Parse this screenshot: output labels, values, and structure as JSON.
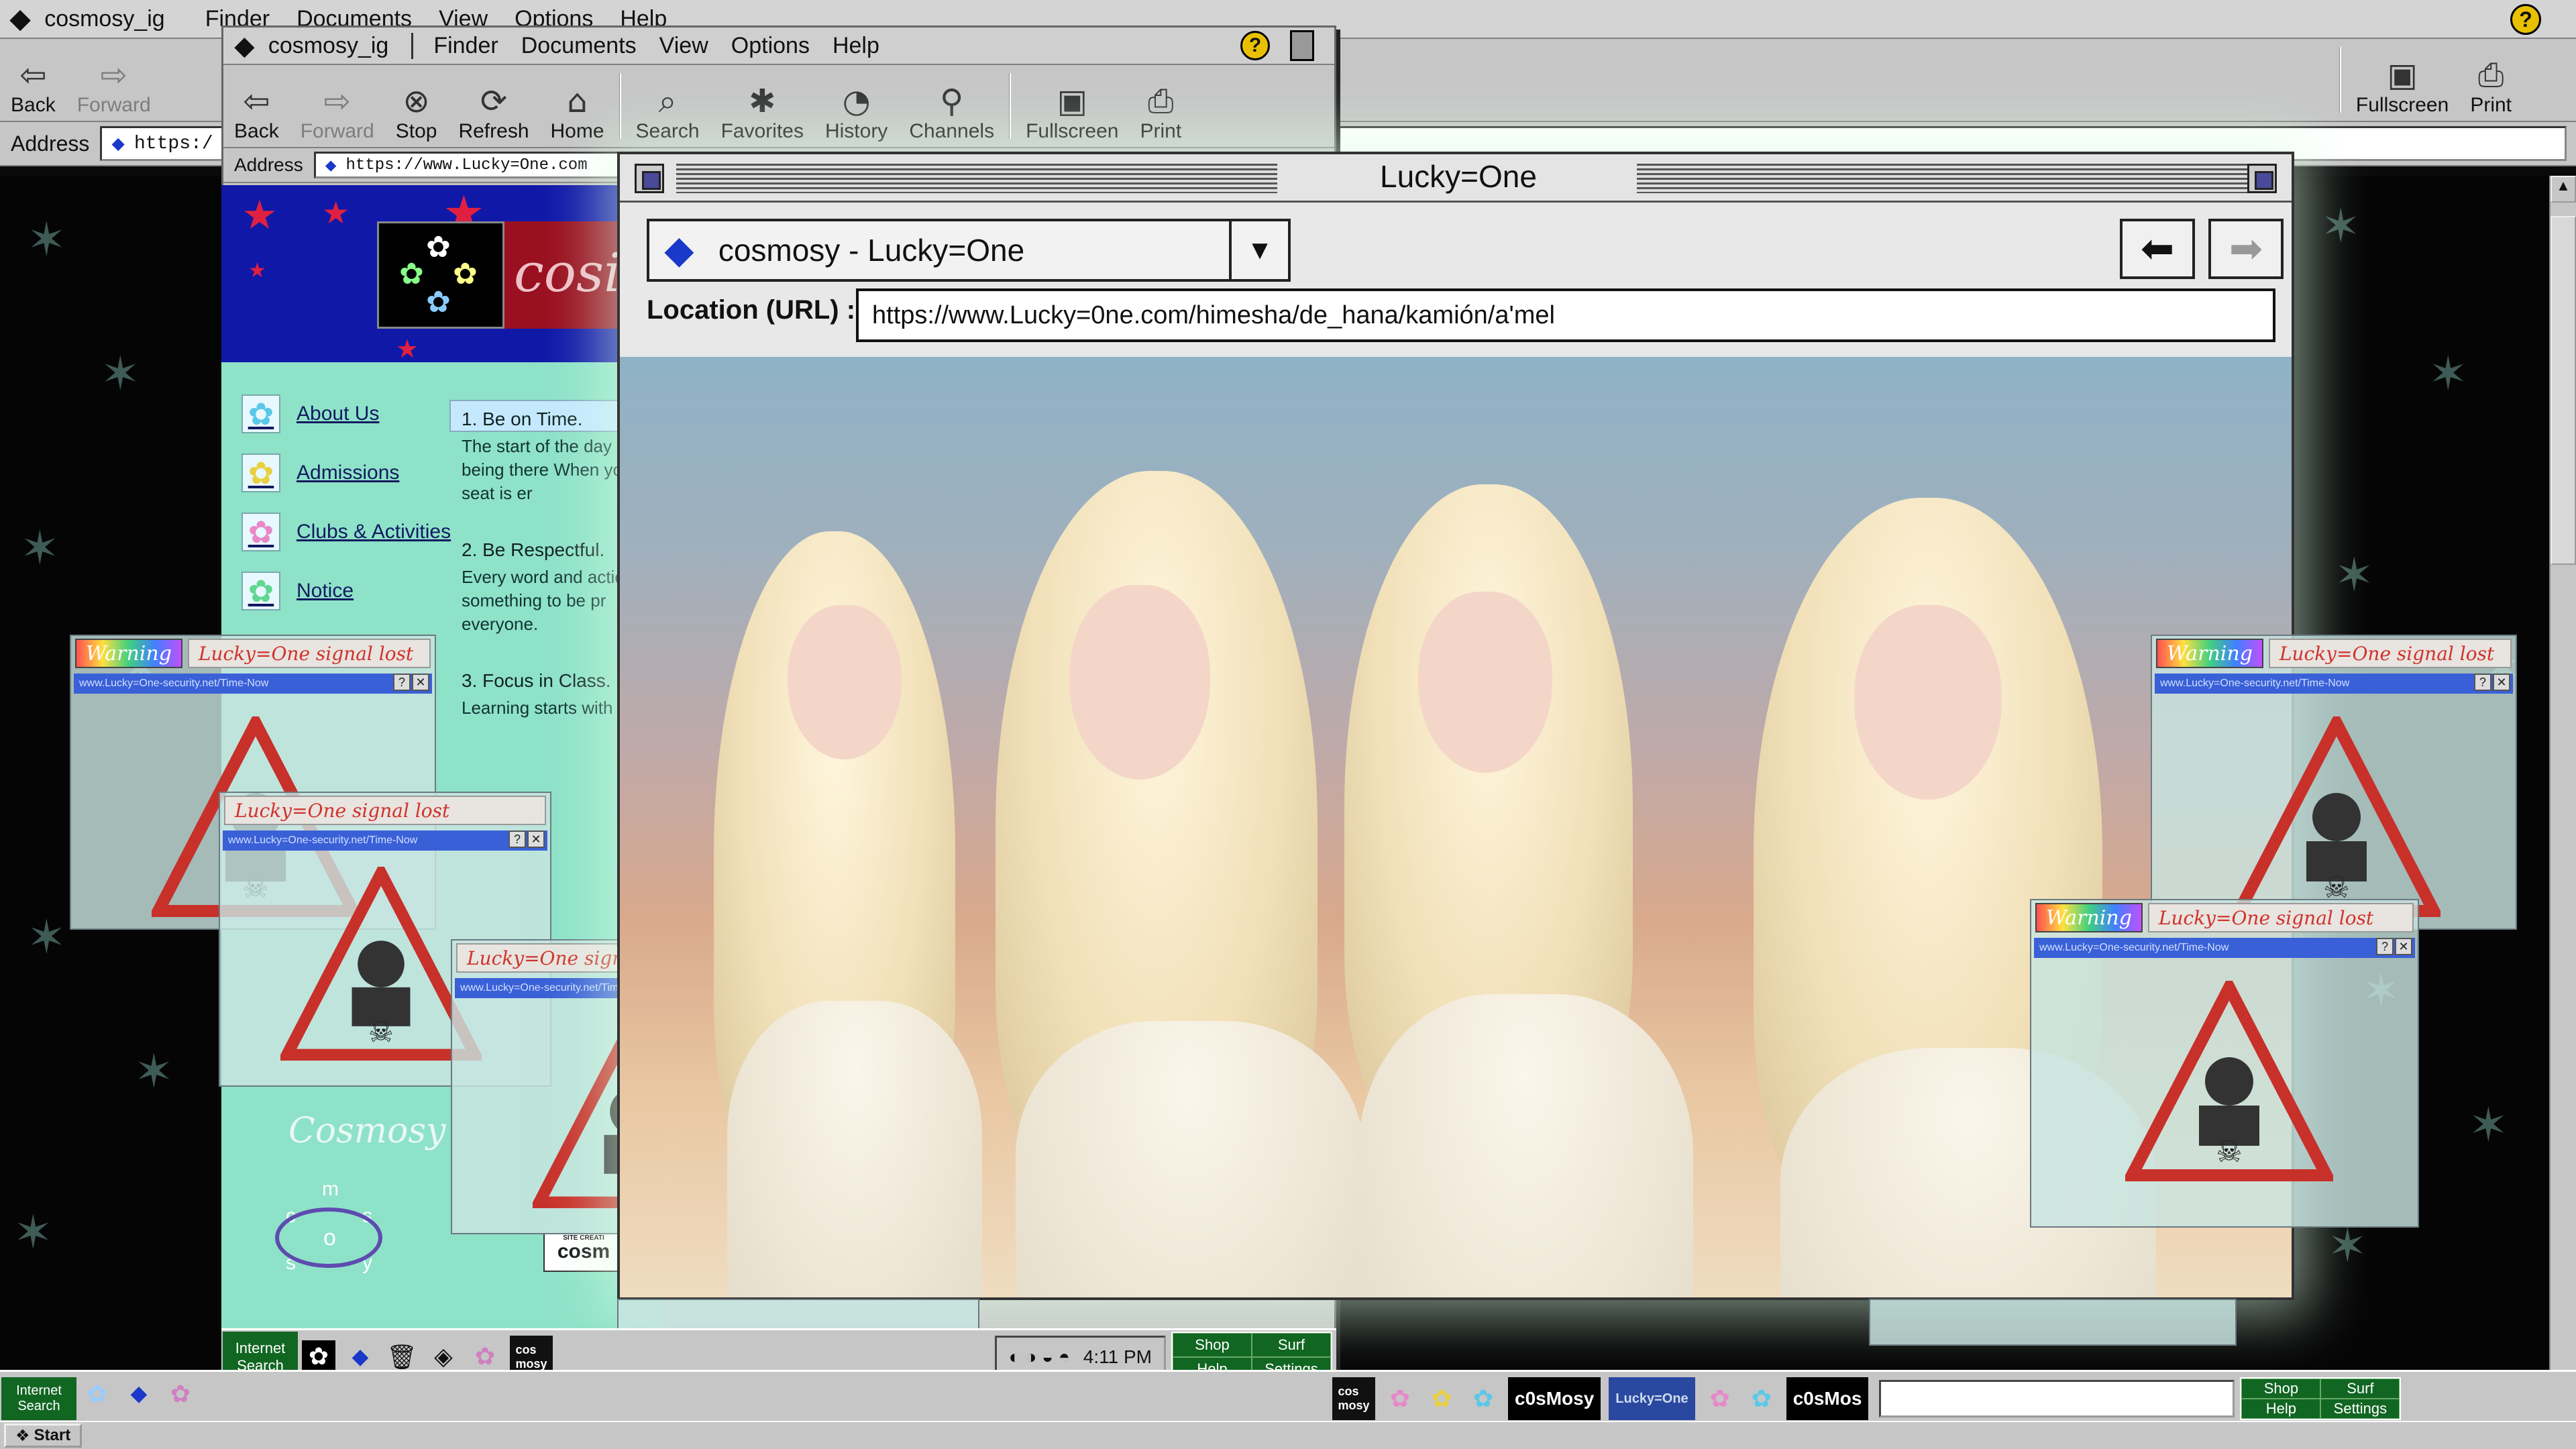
{
  "menubar": {
    "app_name": "cosmosy_ig",
    "menu_items": [
      "Finder",
      "Documents",
      "View",
      "Options",
      "Help"
    ]
  },
  "bg_toolbar": {
    "buttons": [
      "Back",
      "Forward"
    ],
    "right_buttons": [
      "Fullscreen",
      "Print"
    ]
  },
  "bg_address": {
    "label": "Address",
    "value": "https:/"
  },
  "win2": {
    "app_name": "cosmosy_ig",
    "menu_items": [
      "Finder",
      "Documents",
      "View",
      "Options",
      "Help"
    ],
    "toolbar": [
      "Back",
      "Forward",
      "Stop",
      "Refresh",
      "Home",
      "Search",
      "Favorites",
      "History",
      "Channels",
      "Fullscreen",
      "Print"
    ],
    "address_label": "Address",
    "address_value": "https://www.Lucky=One.com"
  },
  "site": {
    "logo_text": "cosi",
    "nav": [
      "About Us",
      "Admissions",
      "Clubs & Activities",
      "Notice"
    ],
    "rules": [
      {
        "title": "1. Be on Time.",
        "body": "The start of the day heavy, being there When your seat is er"
      },
      {
        "title": "2. Be Respectful.",
        "body": "Every word and actio something to be pr everyone."
      },
      {
        "title": "3. Focus in Class.",
        "body": "Learning starts with"
      }
    ],
    "signature": "Cosmosy",
    "footer_logo_letters": [
      "m",
      "c",
      "s",
      "o",
      "s",
      "y"
    ],
    "credit_small": "SITE CREATI",
    "credit_big": "cosm"
  },
  "main_window": {
    "title": "Lucky=One",
    "site_select": "cosmosy - Lucky=One",
    "location_label": "Location (URL) :",
    "location_value": "https://www.Lucky=0ne.com/himesha/de_hana/kamión/a'mel"
  },
  "popups": {
    "warning": "Warning",
    "lost": "Lucky=One signal lost",
    "url": "www.Lucky=One-security.net/Time-Now"
  },
  "taskbar_win2": {
    "internet_label": "Internet",
    "search_label": "Search",
    "shop": [
      "Shop",
      "Surf",
      "Help",
      "Settings"
    ],
    "clock": "4:11 PM",
    "cosmosy_chip": "cos mosy"
  },
  "taskbar_bottom": {
    "start": "Start",
    "internet_label": "Internet",
    "search_label": "Search",
    "shop": [
      "Shop",
      "Surf",
      "Help",
      "Settings"
    ],
    "chips": [
      "cos mosy",
      "c0sMosy",
      "Lucky=One",
      "c0sMos"
    ]
  },
  "colors": {
    "accent_blue": "#1a38c9",
    "site_bg": "#8ee2c8",
    "banner_blue": "#1018a8",
    "warning_red": "#d0322a"
  }
}
